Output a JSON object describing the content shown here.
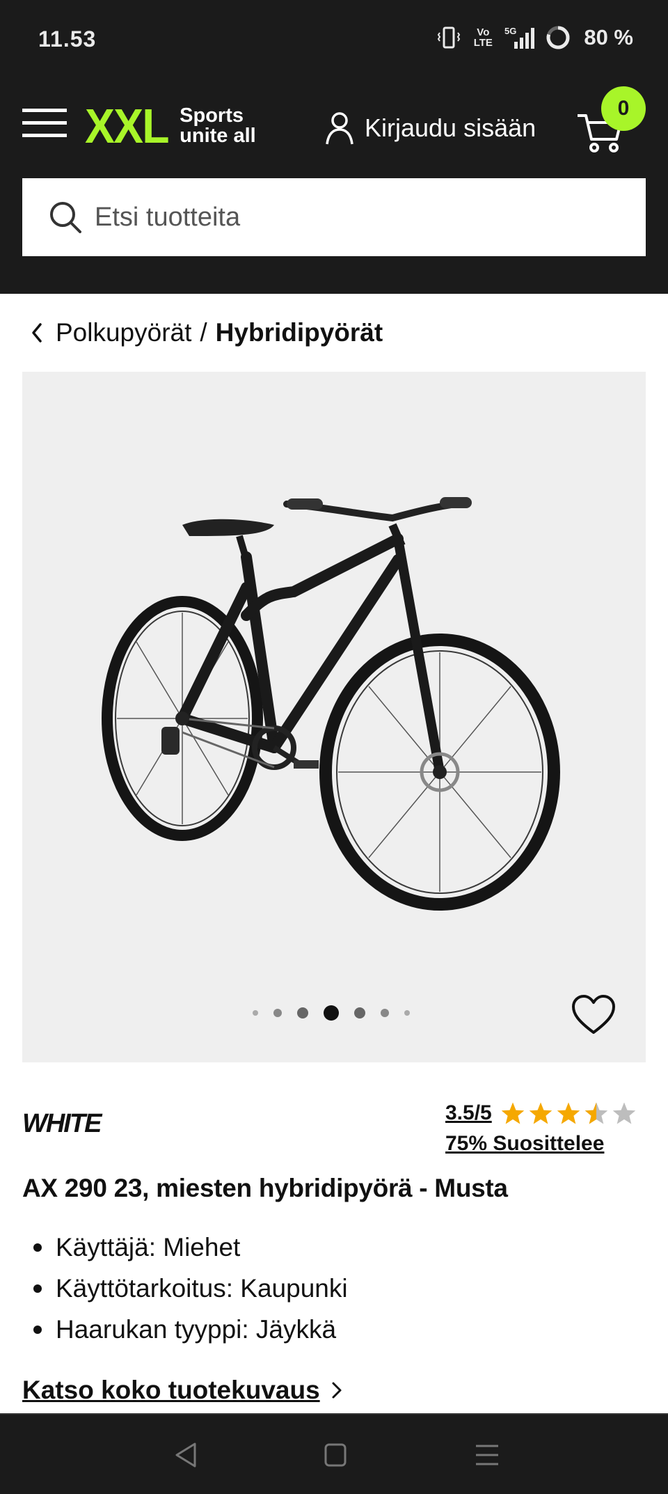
{
  "status_bar": {
    "time": "11.53",
    "network_volte": "Vo LTE",
    "network_5g": "5G",
    "battery": "80 %"
  },
  "header": {
    "logo_text": "XXL",
    "logo_tagline_line1": "Sports",
    "logo_tagline_line2": "unite all",
    "login_label": "Kirjaudu sisään",
    "cart_count": "0",
    "accent_color": "#a8f529",
    "background_color": "#1b1b1b"
  },
  "search": {
    "placeholder": "Etsi tuotteita",
    "value": ""
  },
  "breadcrumb": {
    "parent": "Polkupyörät",
    "separator": "/",
    "current": "Hybridipyörät"
  },
  "gallery": {
    "image_alt": "Black hybrid bicycle",
    "dot_count": 7,
    "active_dot": 4
  },
  "product": {
    "brand": "WHITE",
    "rating_text": "3.5/5",
    "rating_value": 3.5,
    "rating_max": 5,
    "recommend_text": "75% Suosittelee",
    "star_color": "#f5a800",
    "title": "AX 290 23, miesten hybridipyörä - Musta",
    "specs": [
      "Käyttäjä: Miehet",
      "Käyttötarkoitus: Kaupunki",
      "Haarukan tyyppi: Jäykkä"
    ],
    "full_description_link": "Katso koko tuotekuvaus"
  }
}
